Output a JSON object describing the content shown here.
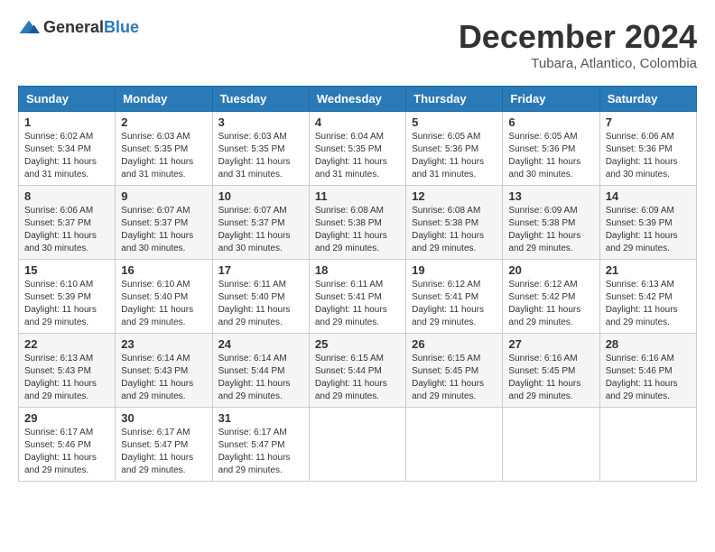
{
  "logo": {
    "general": "General",
    "blue": "Blue"
  },
  "title": {
    "month": "December 2024",
    "location": "Tubara, Atlantico, Colombia"
  },
  "weekdays": [
    "Sunday",
    "Monday",
    "Tuesday",
    "Wednesday",
    "Thursday",
    "Friday",
    "Saturday"
  ],
  "weeks": [
    [
      {
        "day": "1",
        "sunrise": "6:02 AM",
        "sunset": "5:34 PM",
        "daylight": "11 hours and 31 minutes."
      },
      {
        "day": "2",
        "sunrise": "6:03 AM",
        "sunset": "5:35 PM",
        "daylight": "11 hours and 31 minutes."
      },
      {
        "day": "3",
        "sunrise": "6:03 AM",
        "sunset": "5:35 PM",
        "daylight": "11 hours and 31 minutes."
      },
      {
        "day": "4",
        "sunrise": "6:04 AM",
        "sunset": "5:35 PM",
        "daylight": "11 hours and 31 minutes."
      },
      {
        "day": "5",
        "sunrise": "6:05 AM",
        "sunset": "5:36 PM",
        "daylight": "11 hours and 31 minutes."
      },
      {
        "day": "6",
        "sunrise": "6:05 AM",
        "sunset": "5:36 PM",
        "daylight": "11 hours and 30 minutes."
      },
      {
        "day": "7",
        "sunrise": "6:06 AM",
        "sunset": "5:36 PM",
        "daylight": "11 hours and 30 minutes."
      }
    ],
    [
      {
        "day": "8",
        "sunrise": "6:06 AM",
        "sunset": "5:37 PM",
        "daylight": "11 hours and 30 minutes."
      },
      {
        "day": "9",
        "sunrise": "6:07 AM",
        "sunset": "5:37 PM",
        "daylight": "11 hours and 30 minutes."
      },
      {
        "day": "10",
        "sunrise": "6:07 AM",
        "sunset": "5:37 PM",
        "daylight": "11 hours and 30 minutes."
      },
      {
        "day": "11",
        "sunrise": "6:08 AM",
        "sunset": "5:38 PM",
        "daylight": "11 hours and 29 minutes."
      },
      {
        "day": "12",
        "sunrise": "6:08 AM",
        "sunset": "5:38 PM",
        "daylight": "11 hours and 29 minutes."
      },
      {
        "day": "13",
        "sunrise": "6:09 AM",
        "sunset": "5:38 PM",
        "daylight": "11 hours and 29 minutes."
      },
      {
        "day": "14",
        "sunrise": "6:09 AM",
        "sunset": "5:39 PM",
        "daylight": "11 hours and 29 minutes."
      }
    ],
    [
      {
        "day": "15",
        "sunrise": "6:10 AM",
        "sunset": "5:39 PM",
        "daylight": "11 hours and 29 minutes."
      },
      {
        "day": "16",
        "sunrise": "6:10 AM",
        "sunset": "5:40 PM",
        "daylight": "11 hours and 29 minutes."
      },
      {
        "day": "17",
        "sunrise": "6:11 AM",
        "sunset": "5:40 PM",
        "daylight": "11 hours and 29 minutes."
      },
      {
        "day": "18",
        "sunrise": "6:11 AM",
        "sunset": "5:41 PM",
        "daylight": "11 hours and 29 minutes."
      },
      {
        "day": "19",
        "sunrise": "6:12 AM",
        "sunset": "5:41 PM",
        "daylight": "11 hours and 29 minutes."
      },
      {
        "day": "20",
        "sunrise": "6:12 AM",
        "sunset": "5:42 PM",
        "daylight": "11 hours and 29 minutes."
      },
      {
        "day": "21",
        "sunrise": "6:13 AM",
        "sunset": "5:42 PM",
        "daylight": "11 hours and 29 minutes."
      }
    ],
    [
      {
        "day": "22",
        "sunrise": "6:13 AM",
        "sunset": "5:43 PM",
        "daylight": "11 hours and 29 minutes."
      },
      {
        "day": "23",
        "sunrise": "6:14 AM",
        "sunset": "5:43 PM",
        "daylight": "11 hours and 29 minutes."
      },
      {
        "day": "24",
        "sunrise": "6:14 AM",
        "sunset": "5:44 PM",
        "daylight": "11 hours and 29 minutes."
      },
      {
        "day": "25",
        "sunrise": "6:15 AM",
        "sunset": "5:44 PM",
        "daylight": "11 hours and 29 minutes."
      },
      {
        "day": "26",
        "sunrise": "6:15 AM",
        "sunset": "5:45 PM",
        "daylight": "11 hours and 29 minutes."
      },
      {
        "day": "27",
        "sunrise": "6:16 AM",
        "sunset": "5:45 PM",
        "daylight": "11 hours and 29 minutes."
      },
      {
        "day": "28",
        "sunrise": "6:16 AM",
        "sunset": "5:46 PM",
        "daylight": "11 hours and 29 minutes."
      }
    ],
    [
      {
        "day": "29",
        "sunrise": "6:17 AM",
        "sunset": "5:46 PM",
        "daylight": "11 hours and 29 minutes."
      },
      {
        "day": "30",
        "sunrise": "6:17 AM",
        "sunset": "5:47 PM",
        "daylight": "11 hours and 29 minutes."
      },
      {
        "day": "31",
        "sunrise": "6:17 AM",
        "sunset": "5:47 PM",
        "daylight": "11 hours and 29 minutes."
      },
      null,
      null,
      null,
      null
    ]
  ]
}
